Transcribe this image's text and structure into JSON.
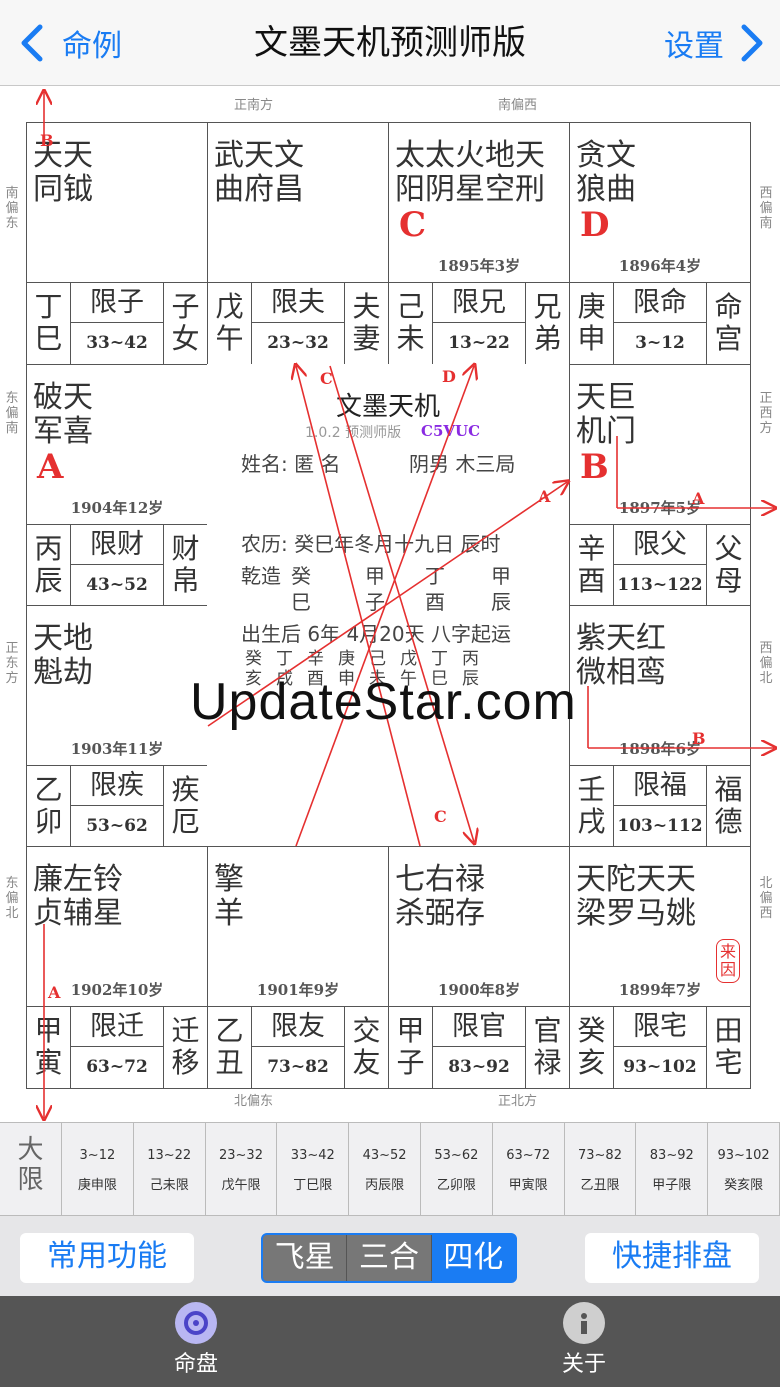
{
  "nav": {
    "back_label": "命例",
    "title": "文墨天机预测师版",
    "settings_label": "设置"
  },
  "directions": {
    "top_left": "正南方",
    "top_right": "南偏西",
    "left_1": "南偏东",
    "left_2": "东偏南",
    "left_3": "正东方",
    "left_4": "东偏北",
    "right_1": "西偏南",
    "right_2": "正西方",
    "right_3": "西偏北",
    "right_4": "北偏西",
    "bottom_left": "北偏东",
    "bottom_right": "正北方"
  },
  "palaces": [
    {
      "stars": [
        "天",
        "天"
      ],
      "stars2": [
        "同",
        "钺"
      ],
      "ganzhi": "丁巳",
      "limit": "限子",
      "range": "33~42",
      "name": "子女",
      "year": ""
    },
    {
      "stars": [
        "武",
        "天",
        "文"
      ],
      "stars2": [
        "曲",
        "府",
        "昌"
      ],
      "ganzhi": "戊午",
      "limit": "限夫",
      "range": "23~32",
      "name": "夫妻",
      "year": ""
    },
    {
      "stars": [
        "太",
        "太",
        "火",
        "地",
        "天"
      ],
      "stars2": [
        "阳",
        "阴",
        "星",
        "空",
        "刑"
      ],
      "ganzhi": "己未",
      "limit": "限兄",
      "range": "13~22",
      "name": "兄弟",
      "year": "1895年3岁",
      "letter": "C"
    },
    {
      "stars": [
        "贪",
        "文"
      ],
      "stars2": [
        "狼",
        "曲"
      ],
      "ganzhi": "庚申",
      "limit": "限命",
      "range": "3~12",
      "name": "命宫",
      "year": "1896年4岁",
      "letter": "D"
    },
    {
      "stars": [
        "破",
        "天"
      ],
      "stars2": [
        "军",
        "喜"
      ],
      "ganzhi": "丙辰",
      "limit": "限财",
      "range": "43~52",
      "name": "财帛",
      "year": "1904年12岁",
      "letter": "A"
    },
    {
      "stars": [
        "天",
        "巨"
      ],
      "stars2": [
        "机",
        "门"
      ],
      "ganzhi": "辛酉",
      "limit": "限父",
      "range": "113~122",
      "name": "父母",
      "year": "1897年5岁",
      "letter": "B"
    },
    {
      "stars": [
        "天",
        "地"
      ],
      "stars2": [
        "魁",
        "劫"
      ],
      "ganzhi": "乙卯",
      "limit": "限疾",
      "range": "53~62",
      "name": "疾厄",
      "year": "1903年11岁"
    },
    {
      "stars": [
        "紫",
        "天",
        "红"
      ],
      "stars2": [
        "微",
        "相",
        "鸾"
      ],
      "ganzhi": "壬戌",
      "limit": "限福",
      "range": "103~112",
      "name": "福德",
      "year": "1898年6岁"
    },
    {
      "stars": [
        "廉",
        "左",
        "铃"
      ],
      "stars2": [
        "贞",
        "辅",
        "星"
      ],
      "ganzhi": "甲寅",
      "limit": "限迁",
      "range": "63~72",
      "name": "迁移",
      "year": "1902年10岁"
    },
    {
      "stars": [
        "擎"
      ],
      "stars2": [
        "羊"
      ],
      "ganzhi": "乙丑",
      "limit": "限友",
      "range": "73~82",
      "name": "交友",
      "year": "1901年9岁"
    },
    {
      "stars": [
        "七",
        "右",
        "禄"
      ],
      "stars2": [
        "杀",
        "弼",
        "存"
      ],
      "ganzhi": "甲子",
      "limit": "限官",
      "range": "83~92",
      "name": "官禄",
      "year": "1900年8岁"
    },
    {
      "stars": [
        "天",
        "陀",
        "天",
        "天"
      ],
      "stars2": [
        "梁",
        "罗",
        "马",
        "姚"
      ],
      "ganzhi": "癸亥",
      "limit": "限宅",
      "range": "93~102",
      "name": "田宅",
      "year": "1899年7岁",
      "stamp": "来因"
    }
  ],
  "center": {
    "title": "文墨天机",
    "version": "1.0.2 预测师版",
    "code": "C5VUC",
    "name_line": "姓名: 匿 名",
    "gender_line": "阴男 木三局",
    "lunar": "农历: 癸巳年冬月十九日 辰时",
    "bazi_label": "乾造",
    "bazi_top": [
      "癸",
      "甲",
      "丁",
      "甲"
    ],
    "bazi_bottom": [
      "巳",
      "子",
      "酉",
      "辰"
    ],
    "qiyun": "出生后 6年 4月20天 八字起运",
    "dy_top": [
      "癸",
      "丁",
      "辛",
      "庚",
      "己",
      "戊",
      "丁",
      "丙"
    ],
    "dy_bottom": [
      "亥",
      "戌",
      "酉",
      "申",
      "未",
      "午",
      "巳",
      "辰"
    ]
  },
  "arrow_labels": {
    "a": "A",
    "b": "B",
    "c": "C",
    "d": "D"
  },
  "dayun": {
    "head": "大限",
    "items": [
      {
        "range": "3~12",
        "label": "庚申限"
      },
      {
        "range": "13~22",
        "label": "己未限"
      },
      {
        "range": "23~32",
        "label": "戊午限"
      },
      {
        "range": "33~42",
        "label": "丁巳限"
      },
      {
        "range": "43~52",
        "label": "丙辰限"
      },
      {
        "range": "53~62",
        "label": "乙卯限"
      },
      {
        "range": "63~72",
        "label": "甲寅限"
      },
      {
        "range": "73~82",
        "label": "乙丑限"
      },
      {
        "range": "83~92",
        "label": "甲子限"
      },
      {
        "range": "93~102",
        "label": "癸亥限"
      }
    ]
  },
  "controls": {
    "common": "常用功能",
    "seg": [
      "飞星",
      "三合",
      "四化"
    ],
    "quick": "快捷排盘"
  },
  "tabs": {
    "chart": "命盘",
    "about": "关于"
  },
  "watermark": "UpdateStar.com",
  "colors": {
    "accent": "#1a7cf3",
    "red": "#e53030",
    "purple": "#8a2be2"
  }
}
